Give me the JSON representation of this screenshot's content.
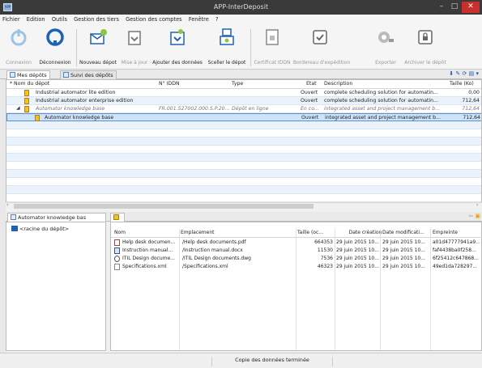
{
  "window": {
    "title": "APP-InterDeposit",
    "icon_text": "APP",
    "buttons": {
      "minimize": "–",
      "maximize": "□",
      "close": "✕"
    }
  },
  "menu": [
    "Fichier",
    "Edition",
    "Outils",
    "Gestion des tiers",
    "Gestion des comptes",
    "Fenêtre",
    "?"
  ],
  "toolbar": {
    "connexion": "Connexion",
    "deconnexion": "Déconnexion",
    "nouveau_depot": "Nouveau dépot",
    "mise_a_jour": "Mise à jour",
    "ajouter_donnees": "Ajouter des données",
    "sceller_depot": "Sceller le dépot",
    "certificat": "Certificat IDDN",
    "bordereau": "Bordereau d'expédition",
    "exporter": "Exporter",
    "archiver": "Archiver le dépôt"
  },
  "tabs": {
    "mes_depots": "Mes dépôts",
    "suivi": "Suivi des dépôts"
  },
  "grid": {
    "columns": [
      "* Nom du dépot",
      "N° IDDN",
      "Type",
      "Etat",
      "Description",
      "Taille (Ko)"
    ],
    "rows": [
      {
        "name": "Industrial automator lite edition",
        "iddn": "",
        "type": "",
        "etat": "Ouvert",
        "desc": "complete scheduling solution for automatin...",
        "taille": "0,00"
      },
      {
        "name": "Industrial automator enterprise edition",
        "iddn": "",
        "type": "",
        "etat": "Ouvert",
        "desc": "complete scheduling solution for automatin...",
        "taille": "712,64"
      },
      {
        "name": "Automator knowledge base",
        "iddn": "FR.001.527002.000.S.P.20...",
        "type": "Dépôt en ligne",
        "etat": "En co...",
        "desc": "integrated asset and project management b...",
        "taille": "712,64"
      },
      {
        "name": "Automator knowledge base",
        "iddn": "",
        "type": "",
        "etat": "Ouvert",
        "desc": "integrated asset and project management b...",
        "taille": "712,64"
      }
    ],
    "expander": "◢"
  },
  "lower": {
    "tree_tab": "Automator knowledge bas",
    "path_tab": "/",
    "root": "<racine du dépôt>",
    "columns": [
      "Nom",
      "Emplacement",
      "Taille (oc...",
      "Date création",
      "Date modificati...",
      "Empreinte"
    ],
    "files": [
      {
        "name": "Help desk documen...",
        "loc": "/Help desk documents.pdf",
        "size": "664353",
        "created": "29 juin 2015 10...",
        "modified": "29 juin 2015 10...",
        "hash": "a01d47777941a9..."
      },
      {
        "name": "Instruction manual...",
        "loc": "/Instruction manual.docx",
        "size": "11530",
        "created": "29 juin 2015 10...",
        "modified": "29 juin 2015 10...",
        "hash": "faf4438ba0f258..."
      },
      {
        "name": "ITIL Design docume...",
        "loc": "/ITIL Design documents.dwg",
        "size": "7536",
        "created": "29 juin 2015 10...",
        "modified": "29 juin 2015 10...",
        "hash": "6f25412c647868..."
      },
      {
        "name": "Specifications.xml",
        "loc": "/Specifications.xml",
        "size": "46323",
        "created": "29 juin 2015 10...",
        "modified": "29 juin 2015 10...",
        "hash": "49ed1da728297..."
      }
    ]
  },
  "status": "Copie des données terminée",
  "colors": {
    "accent": "#1e62b8",
    "selection": "#cfe2f7",
    "close": "#c9302c"
  }
}
